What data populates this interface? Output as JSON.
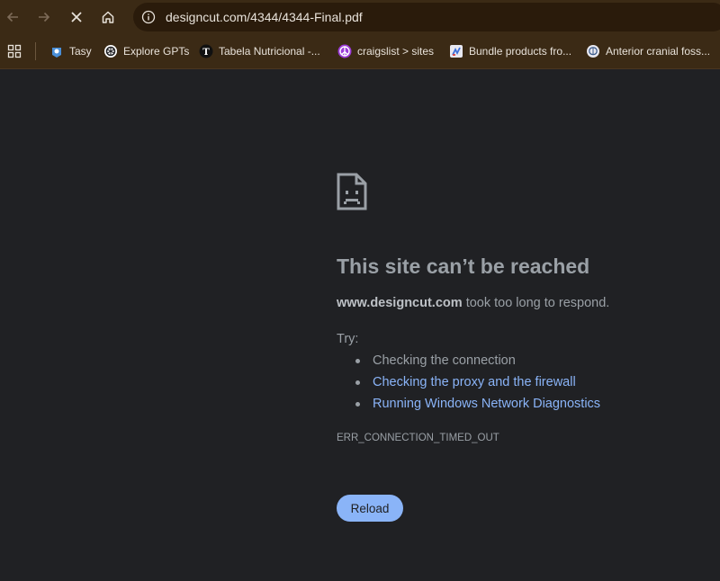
{
  "browser": {
    "url": "designcut.com/4344/4344-Final.pdf",
    "nav_icons": [
      "back-arrow-icon",
      "forward-arrow-icon",
      "stop-loading-icon",
      "home-icon"
    ],
    "site_info_icon": "info-icon"
  },
  "bookmarks": [
    {
      "label": "Tasy",
      "icon": "tasy-icon"
    },
    {
      "label": "Explore GPTs",
      "icon": "openai-icon"
    },
    {
      "label": "Tabela Nutricional -...",
      "icon": "t-icon"
    },
    {
      "label": "craigslist > sites",
      "icon": "peace-icon"
    },
    {
      "label": "Bundle products fro...",
      "icon": "bundle-icon"
    },
    {
      "label": "Anterior cranial foss...",
      "icon": "brain-icon"
    }
  ],
  "error_page": {
    "icon": "sad-page-icon",
    "title": "This site can’t be reached",
    "host": "www.designcut.com",
    "message": "took too long to respond.",
    "try_label": "Try:",
    "suggestions": [
      {
        "text": "Checking the connection",
        "is_link": false
      },
      {
        "text": "Checking the proxy and the firewall",
        "is_link": true
      },
      {
        "text": "Running Windows Network Diagnostics",
        "is_link": true
      }
    ],
    "error_code": "ERR_CONNECTION_TIMED_OUT",
    "reload_label": "Reload"
  },
  "colors": {
    "toolbar_bg": "#3b2a15",
    "page_bg": "#202124",
    "link": "#8ab4f8",
    "button": "#8ab4f8"
  }
}
